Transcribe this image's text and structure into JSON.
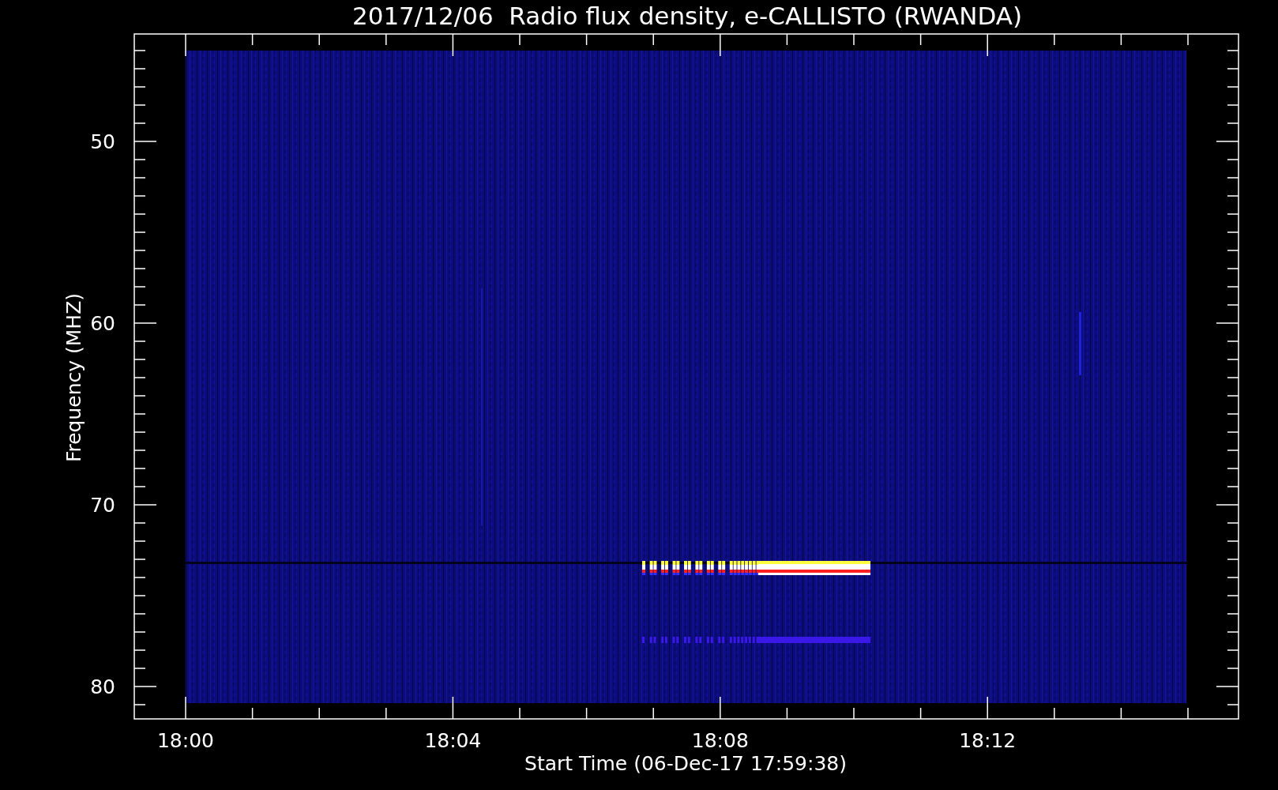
{
  "title": "2017/12/06  Radio flux density, e-CALLISTO (RWANDA)",
  "y_axis": {
    "label": "Frequency (MHZ)",
    "ticks": [
      "50",
      "60",
      "70",
      "80"
    ]
  },
  "x_axis": {
    "label": "Start Time (06-Dec-17 17:59:38)",
    "ticks": [
      "18:00",
      "18:04",
      "18:08",
      "18:12"
    ]
  }
}
